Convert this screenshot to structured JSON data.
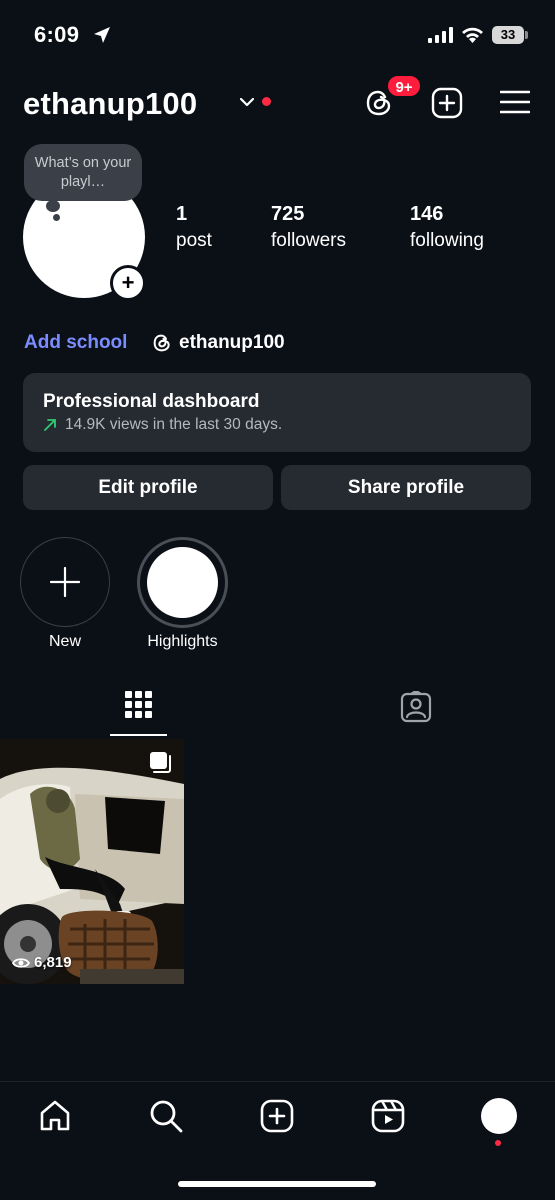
{
  "status_bar": {
    "time": "6:09",
    "battery": "33"
  },
  "header": {
    "username": "ethanup100",
    "threads_badge": "9+",
    "icons": [
      "threads-icon",
      "new-post-icon",
      "menu-icon"
    ]
  },
  "profile": {
    "note": "What’s on your playl…",
    "stats": {
      "posts_count": "1",
      "posts_label": "post",
      "followers_count": "725",
      "followers_label": "followers",
      "following_count": "146",
      "following_label": "following"
    },
    "add_school": "Add school",
    "threads_handle": "ethanup100"
  },
  "dashboard": {
    "title": "Professional dashboard",
    "subtitle": "14.9K views in the last 30 days.",
    "trend_color": "#2ecc71"
  },
  "buttons": {
    "edit_profile": "Edit profile",
    "share_profile": "Share profile"
  },
  "highlights": [
    {
      "label": "New"
    },
    {
      "label": "Highlights"
    }
  ],
  "tabs": [
    "grid-icon",
    "tagged-icon"
  ],
  "posts": [
    {
      "views": "6,819",
      "type": "carousel"
    }
  ],
  "bottom_nav": [
    "home-icon",
    "search-icon",
    "create-icon",
    "reels-icon",
    "profile-avatar"
  ],
  "colors": {
    "background": "#0b0f16",
    "surface": "#262a31",
    "accent_link": "#7b8cff",
    "notification_red": "#ff1d3d"
  }
}
